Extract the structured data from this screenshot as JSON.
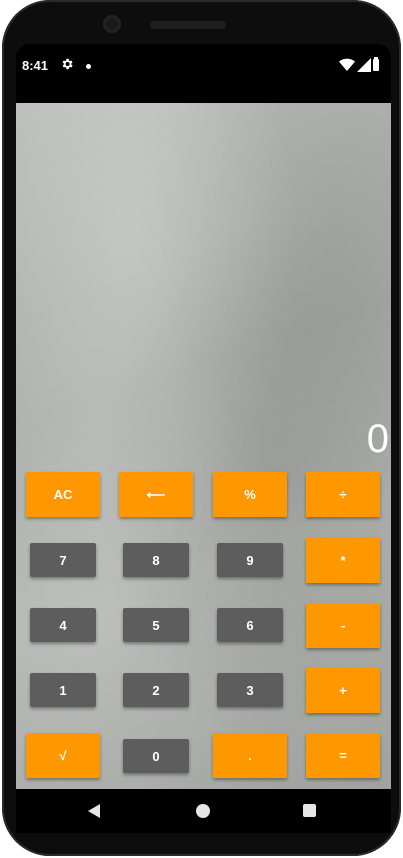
{
  "status_bar": {
    "time": "8:41",
    "icons": [
      "gear-icon",
      "notification-dot-icon",
      "wifi-icon",
      "signal-icon",
      "battery-icon"
    ]
  },
  "display": {
    "value": "0"
  },
  "colors": {
    "operator": "#ff9800",
    "digit": "#5d5d5d",
    "text": "#ffffff"
  },
  "keys": {
    "ac": "AC",
    "backspace": "⟵",
    "percent": "%",
    "divide": "÷",
    "seven": "7",
    "eight": "8",
    "nine": "9",
    "multiply": "*",
    "four": "4",
    "five": "5",
    "six": "6",
    "minus": "-",
    "one": "1",
    "two": "2",
    "three": "3",
    "plus": "+",
    "sqrt": "√",
    "zero": "0",
    "dot": ".",
    "equals": "="
  },
  "nav_bar": {
    "icons": [
      "back-icon",
      "home-icon",
      "recents-icon"
    ]
  }
}
